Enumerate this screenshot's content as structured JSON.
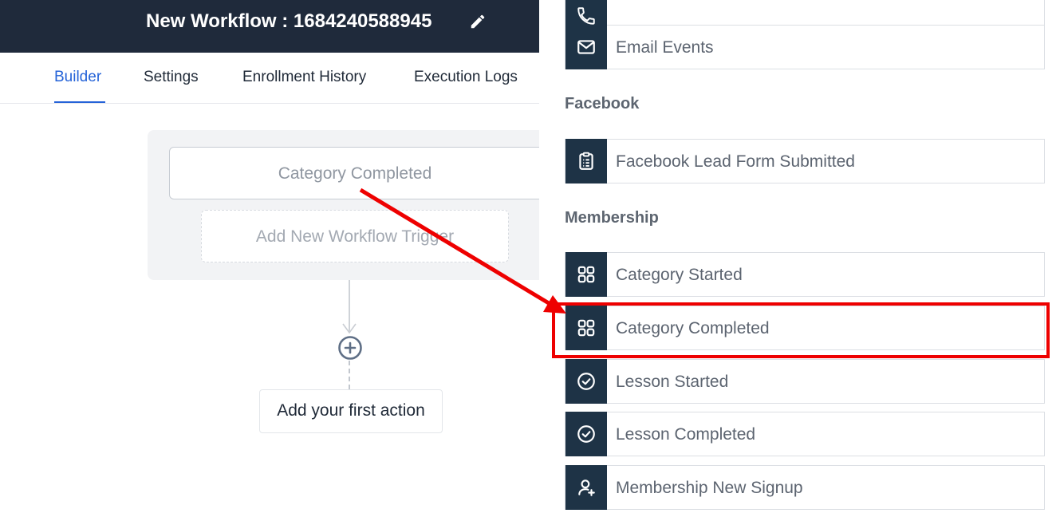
{
  "header": {
    "title": "New Workflow : 1684240588945",
    "edit_icon": "pencil-icon"
  },
  "tabs": [
    {
      "label": "Builder",
      "active": true
    },
    {
      "label": "Settings",
      "active": false
    },
    {
      "label": "Enrollment History",
      "active": false
    },
    {
      "label": "Execution Logs",
      "active": false
    }
  ],
  "canvas": {
    "trigger": "Category Completed",
    "add_trigger": "Add New Workflow Trigger",
    "add_action": "Add your first action"
  },
  "panel": {
    "items_top": [
      {
        "label": "",
        "icon": "phone-icon"
      },
      {
        "label": "Email Events",
        "icon": "mail-icon"
      }
    ],
    "sections": [
      {
        "title": "Facebook",
        "items": [
          {
            "label": "Facebook Lead Form Submitted",
            "icon": "clipboard-icon"
          }
        ]
      },
      {
        "title": "Membership",
        "items": [
          {
            "label": "Category Started",
            "icon": "grid-icon"
          },
          {
            "label": "Category Completed",
            "icon": "grid-icon"
          },
          {
            "label": "Lesson Started",
            "icon": "check-circle-icon"
          },
          {
            "label": "Lesson Completed",
            "icon": "check-circle-icon"
          },
          {
            "label": "Membership New Signup",
            "icon": "user-plus-icon"
          }
        ]
      }
    ]
  },
  "colors": {
    "header_bg": "#1f2a3b",
    "accent": "#2563d8",
    "icon_bg": "#1e3346",
    "annotation": "#ee0000"
  }
}
